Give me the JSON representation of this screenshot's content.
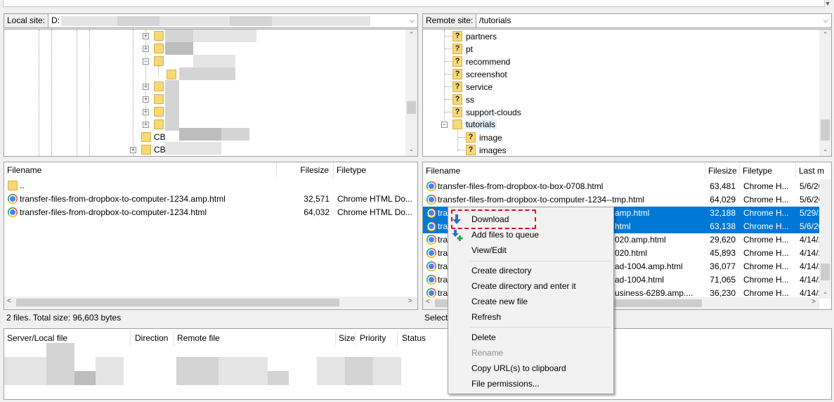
{
  "local_site": {
    "label": "Local site:",
    "path": "D:",
    "tree_items": [
      "CB",
      "CB"
    ]
  },
  "remote_site": {
    "label": "Remote site:",
    "path": "/tutorials",
    "tree_items": [
      "partners",
      "pt",
      "recommend",
      "screenshot",
      "service",
      "ss",
      "support-clouds",
      "tutorials",
      "image",
      "images"
    ]
  },
  "local_list": {
    "headers": {
      "filename": "Filename",
      "filesize": "Filesize",
      "filetype": "Filetype"
    },
    "rows": [
      {
        "name": "..",
        "size": "",
        "type": ""
      },
      {
        "name": "transfer-files-from-dropbox-to-computer-1234.amp.html",
        "size": "32,571",
        "type": "Chrome HTML Do..."
      },
      {
        "name": "transfer-files-from-dropbox-to-computer-1234.html",
        "size": "64,032",
        "type": "Chrome HTML Do..."
      }
    ],
    "status": "2 files. Total size: 96,603 bytes"
  },
  "remote_list": {
    "headers": {
      "filename": "Filename",
      "filesize": "Filesize",
      "filetype": "Filetype",
      "lastmod": "Last m"
    },
    "rows": [
      {
        "name": "transfer-files-from-dropbox-to-box-0708.html",
        "size": "63,481",
        "type": "Chrome H...",
        "date": "5/6/20"
      },
      {
        "name": "transfer-files-from-dropbox-to-computer-1234--tmp.html",
        "size": "64,029",
        "type": "Chrome H...",
        "date": "5/6/20"
      },
      {
        "name": "tra",
        "name_tail": "amp.html",
        "size": "32,188",
        "type": "Chrome H...",
        "date": "5/29/2"
      },
      {
        "name": "tra",
        "name_tail": "html",
        "size": "63,138",
        "type": "Chrome H...",
        "date": "5/6/20"
      },
      {
        "name": "tra",
        "name_tail": "020.amp.html",
        "size": "29,620",
        "type": "Chrome H...",
        "date": "4/14/2"
      },
      {
        "name": "tra",
        "name_tail": "020.html",
        "size": "45,893",
        "type": "Chrome H...",
        "date": "4/14/2"
      },
      {
        "name": "tra",
        "name_tail": "ad-1004.amp.html",
        "size": "36,077",
        "type": "Chrome H...",
        "date": "4/14/2"
      },
      {
        "name": "tra",
        "name_tail": "ad-1004.html",
        "size": "71,065",
        "type": "Chrome H...",
        "date": "4/14/2"
      },
      {
        "name": "tra",
        "name_tail": "usiness-6289.amp....",
        "size": "36,230",
        "type": "Chrome H...",
        "date": "4/14/2"
      }
    ],
    "status": "Selecte"
  },
  "queue": {
    "headers": {
      "server": "Server/Local file",
      "direction": "Direction",
      "remote": "Remote file",
      "size": "Size",
      "priority": "Priority",
      "status": "Status"
    }
  },
  "context_menu": {
    "download": "Download",
    "add_to_queue": "Add files to queue",
    "view_edit": "View/Edit",
    "create_dir": "Create directory",
    "create_dir_enter": "Create directory and enter it",
    "create_file": "Create new file",
    "refresh": "Refresh",
    "delete": "Delete",
    "rename": "Rename",
    "copy_url": "Copy URL(s) to clipboard",
    "file_perms": "File permissions..."
  },
  "colors": {
    "selection": "#0078d7",
    "highlight_border": "#e0101e",
    "folder": "#f8d775"
  },
  "icons": {
    "file_type": "chrome-icon",
    "folder": "folder-icon",
    "unknown_folder": "question-folder-icon",
    "download": "download-arrow-icon",
    "add_queue": "add-queue-icon"
  }
}
